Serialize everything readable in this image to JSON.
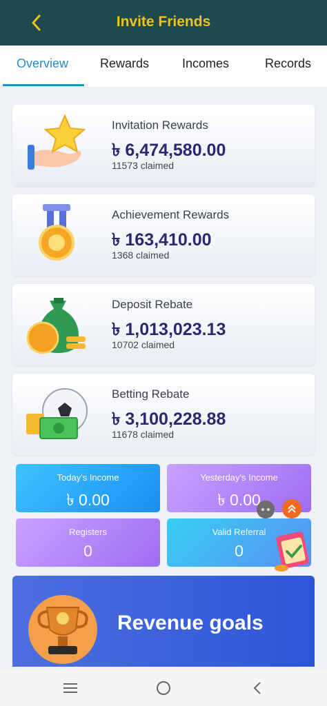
{
  "header": {
    "title": "Invite Friends",
    "back_icon": "chevron-left-icon"
  },
  "tabs": [
    {
      "label": "Overview",
      "active": true
    },
    {
      "label": "Rewards",
      "active": false
    },
    {
      "label": "Incomes",
      "active": false
    },
    {
      "label": "Records",
      "active": false
    }
  ],
  "cards": [
    {
      "title": "Invitation Rewards",
      "value": "৳ 6,474,580.00",
      "claimed": "11573 claimed",
      "icon": "star-hand-icon"
    },
    {
      "title": "Achievement Rewards",
      "value": "৳ 163,410.00",
      "claimed": "1368 claimed",
      "icon": "medal-icon"
    },
    {
      "title": "Deposit Rebate",
      "value": "৳ 1,013,023.13",
      "claimed": "10702 claimed",
      "icon": "money-bag-icon"
    },
    {
      "title": "Betting Rebate",
      "value": "৳ 3,100,228.88",
      "claimed": "11678 claimed",
      "icon": "soccer-money-icon"
    }
  ],
  "stats": {
    "today_income": {
      "label": "Today's Income",
      "value": "৳ 0.00"
    },
    "yesterday_income": {
      "label": "Yesterday's Income",
      "value": "৳ 0.00"
    },
    "registers": {
      "label": "Registers",
      "value": "0"
    },
    "valid_referral": {
      "label": "Valid Referral",
      "value": "0"
    }
  },
  "revenue": {
    "title": "Revenue goals",
    "icon": "trophy-icon"
  },
  "colors": {
    "header_bg": "#1e4a4e",
    "header_title": "#f2c21b",
    "tab_active": "#2a8bc7",
    "value_text": "#2a2870"
  },
  "system_nav": {
    "icons": [
      "menu-icon",
      "home-circle-icon",
      "back-icon"
    ]
  }
}
